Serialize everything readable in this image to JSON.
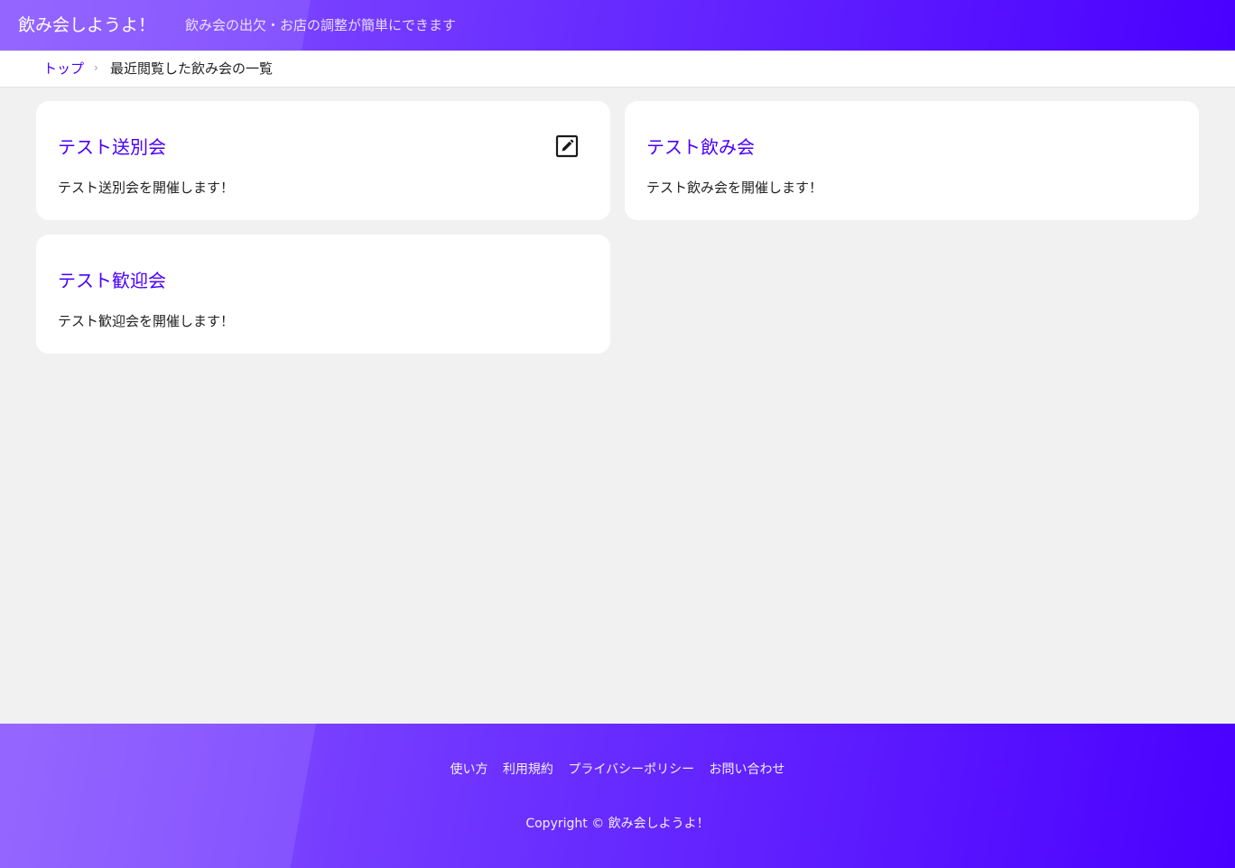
{
  "header": {
    "site_title": "飲み会しようよ！",
    "tagline": "飲み会の出欠・お店の調整が簡単にできます"
  },
  "breadcrumb": {
    "home": "トップ",
    "separator": "›",
    "current": "最近閲覧した飲み会の一覧"
  },
  "events": [
    {
      "title": "テスト送別会",
      "description": "テスト送別会を開催します！",
      "icon": "edit-icon"
    },
    {
      "title": "テスト飲み会",
      "description": "テスト飲み会を開催します！"
    },
    {
      "title": "テスト歓迎会",
      "description": "テスト歓迎会を開催します！"
    }
  ],
  "footer": {
    "links": [
      "使い方",
      "利用規約",
      "プライバシーポリシー",
      "お問い合わせ"
    ],
    "copyright": "Copyright © 飲み会しようよ！"
  },
  "colors": {
    "accent": "#4a00ff",
    "gradient_start": "#8a56ff",
    "gradient_end": "#4a00ff",
    "background": "#f1f1f1",
    "card": "#ffffff"
  }
}
